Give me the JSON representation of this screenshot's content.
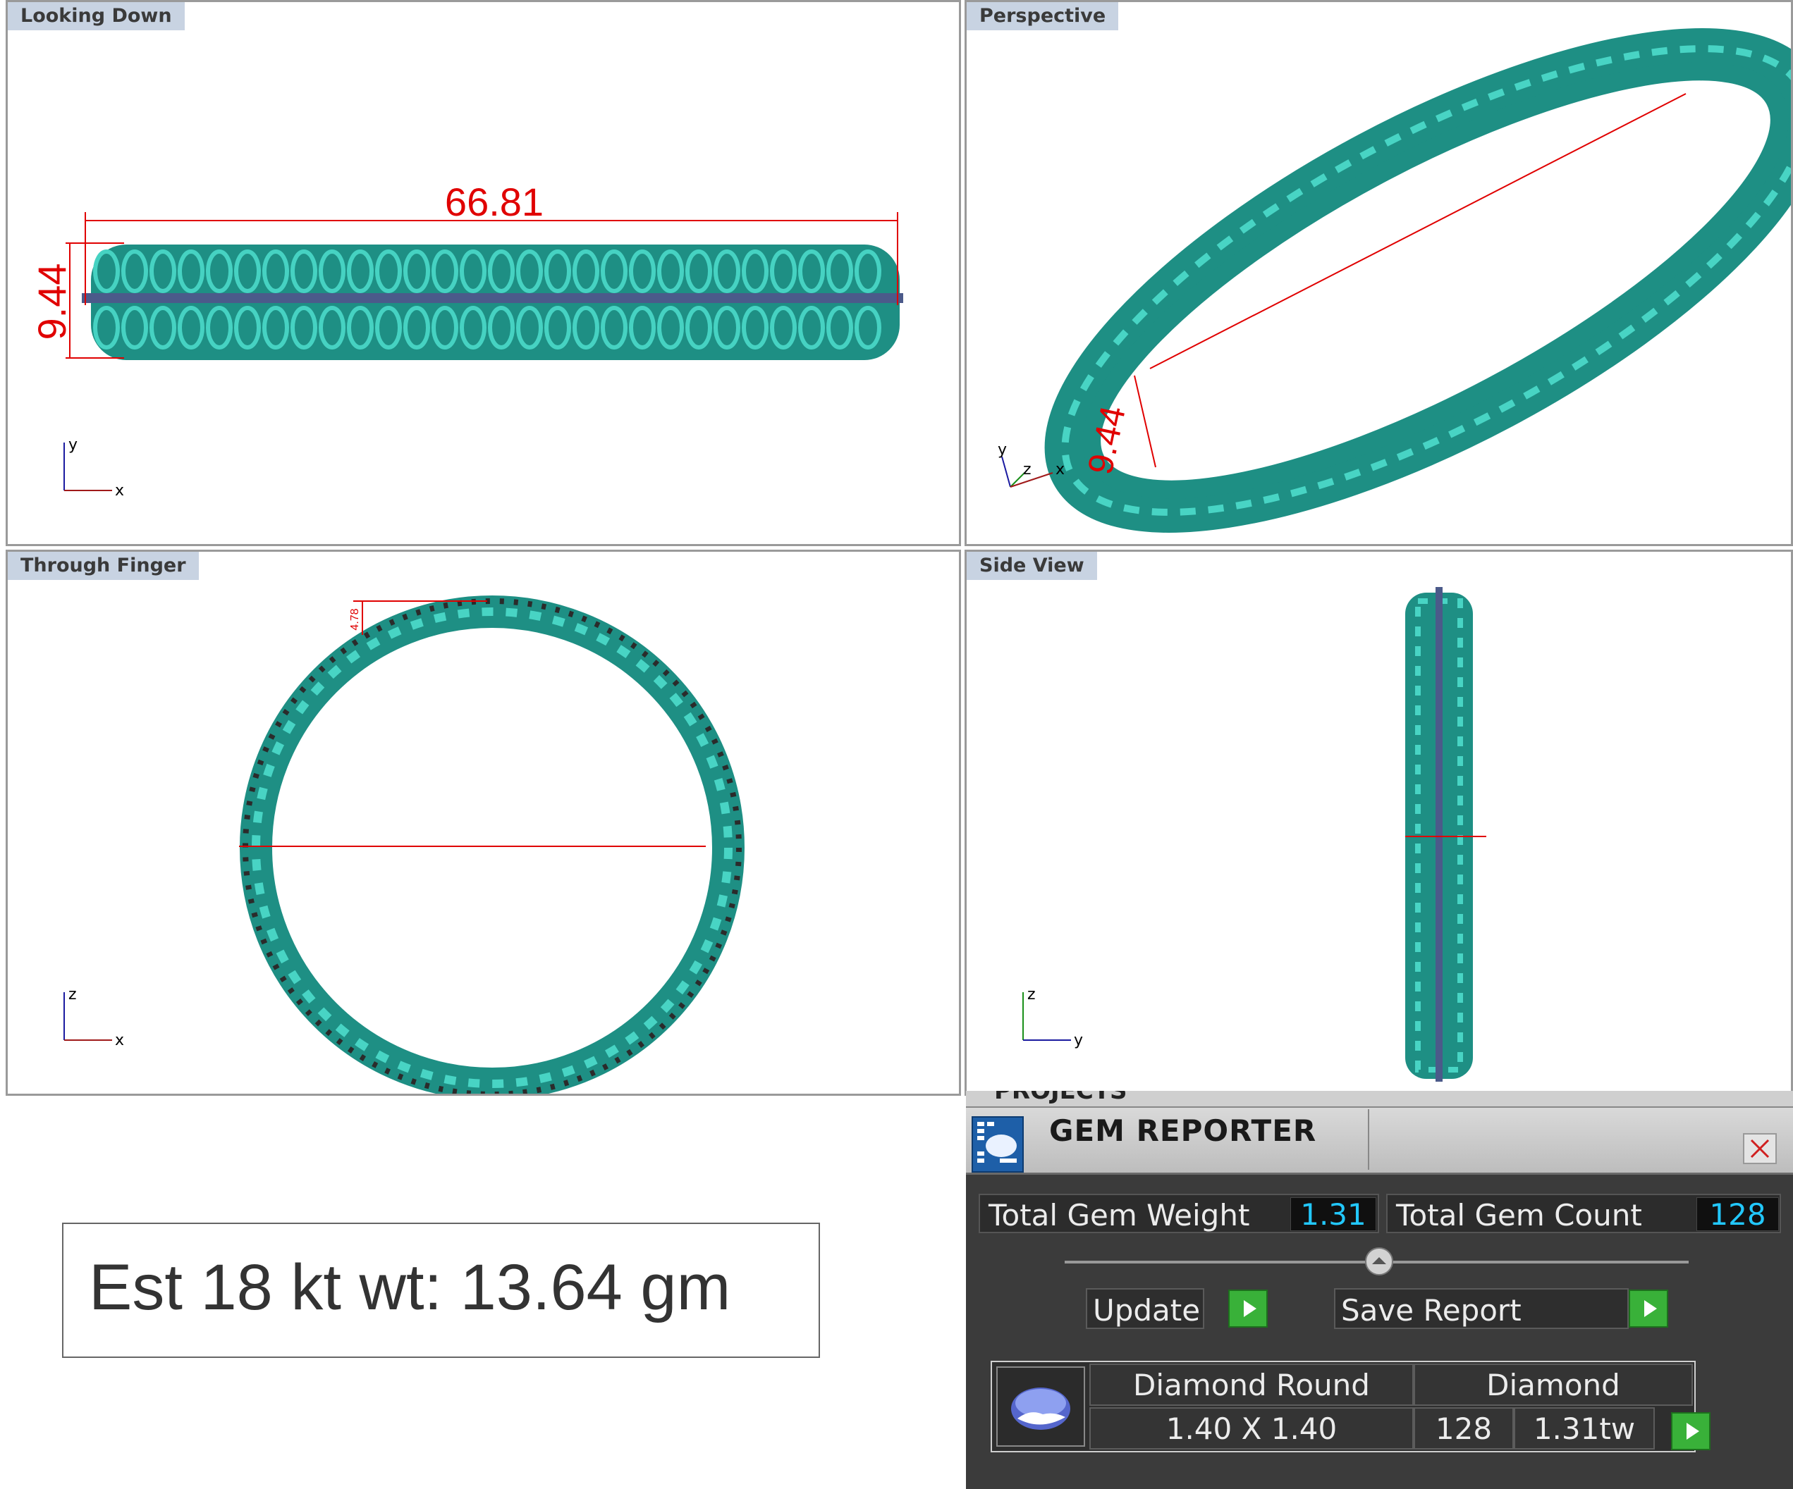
{
  "viewports": {
    "top": {
      "label": "Looking Down",
      "dim_width": "66.81",
      "dim_height": "9.44",
      "axis_1": "y",
      "axis_2": "x"
    },
    "persp": {
      "label": "Perspective",
      "dim_height": "9.44",
      "axis_1": "y",
      "axis_2": "z",
      "axis_3": "x"
    },
    "front": {
      "label": "Through Finger",
      "dim_small": "4.78",
      "axis_1": "z",
      "axis_2": "x"
    },
    "right": {
      "label": "Side View",
      "axis_1": "z",
      "axis_2": "y"
    }
  },
  "estimate": {
    "text": "Est 18 kt wt: 13.64 gm"
  },
  "gem_reporter": {
    "projects_label": "PROJECTS",
    "title": "GEM REPORTER",
    "total_weight_label": "Total Gem Weight",
    "total_weight_value": "1.31",
    "total_count_label": "Total Gem Count",
    "total_count_value": "128",
    "update_label": "Update",
    "save_report_label": "Save Report",
    "table": {
      "shape": "Diamond Round",
      "material": "Diamond",
      "size": "1.40 X 1.40",
      "count": "128",
      "weight": "1.31tw"
    }
  },
  "colors": {
    "ring": "#2aa89a",
    "dimension": "#e00000",
    "accent_value": "#22c8ff"
  }
}
